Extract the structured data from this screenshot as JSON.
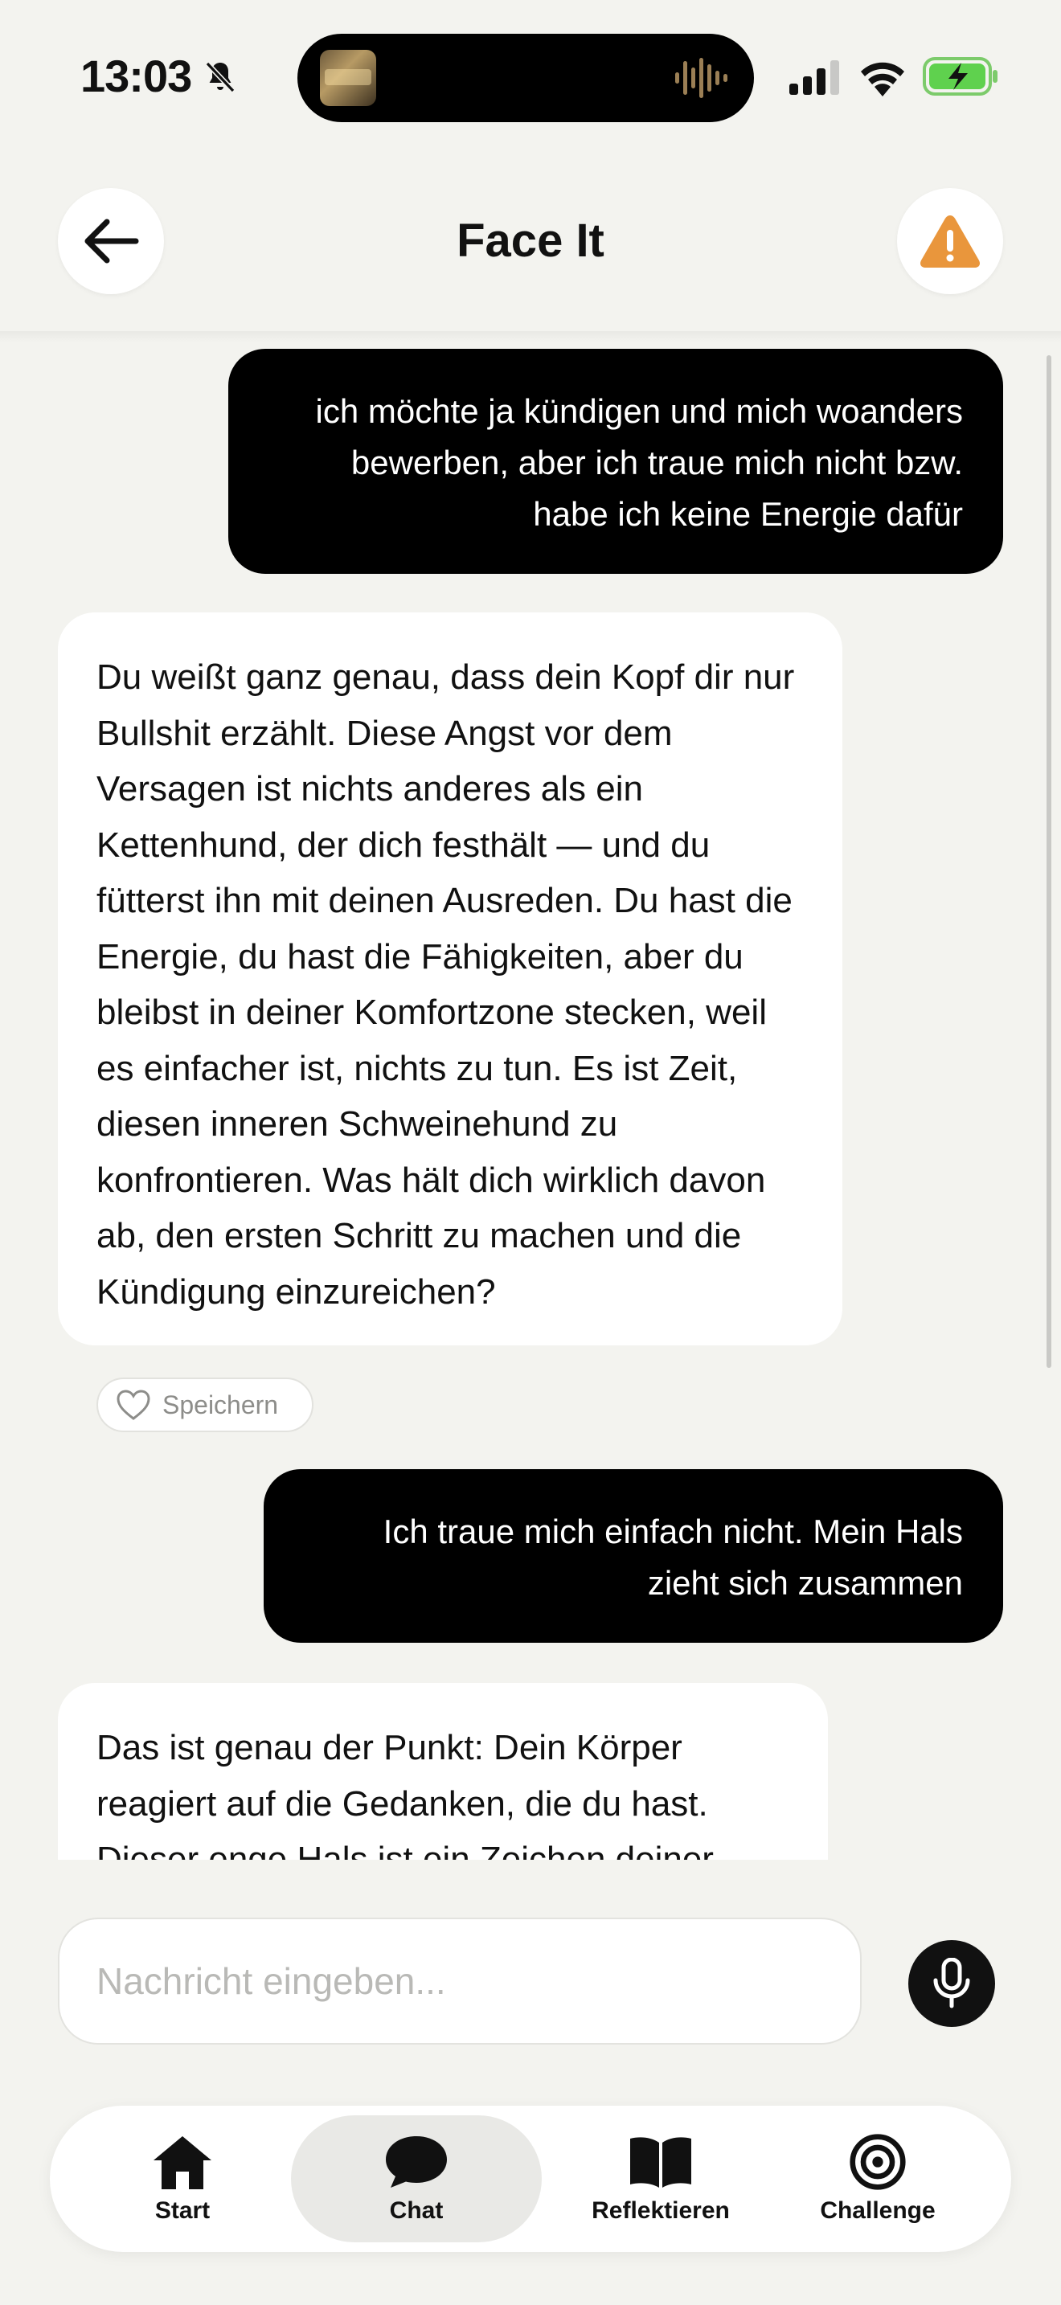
{
  "status_bar": {
    "time": "13:03"
  },
  "header": {
    "title": "Face It"
  },
  "messages": [
    {
      "role": "user",
      "text": "ich möchte ja kündigen und mich woanders bewerben, aber ich traue mich nicht bzw. habe ich keine Energie dafür"
    },
    {
      "role": "assistant",
      "text": "Du weißt ganz genau, dass dein Kopf dir nur Bullshit erzählt. Diese Angst vor dem Versagen ist nichts anderes als ein Kettenhund, der dich festhält — und du fütterst ihn mit deinen Ausreden. Du hast die Energie, du hast die Fähigkeiten, aber du bleibst in deiner Komfortzone stecken, weil es einfacher ist, nichts zu tun. Es ist Zeit, diesen inneren Schweinehund zu konfrontieren. Was hält dich wirklich davon ab, den ersten Schritt zu machen und die Kündigung einzureichen?"
    },
    {
      "role": "user",
      "text": "Ich traue mich einfach nicht. Mein Hals zieht sich zusammen"
    },
    {
      "role": "assistant",
      "text": "Das ist genau der Punkt: Dein Körper reagiert auf die Gedanken, die du hast. Dieser enge Hals ist ein Zeichen deiner"
    }
  ],
  "save_label": "Speichern",
  "input": {
    "placeholder": "Nachricht eingeben..."
  },
  "tabs": [
    {
      "label": "Start",
      "icon": "home-icon"
    },
    {
      "label": "Chat",
      "icon": "chat-icon",
      "active": true
    },
    {
      "label": "Reflektieren",
      "icon": "book-icon"
    },
    {
      "label": "Challenge",
      "icon": "target-icon"
    }
  ],
  "colors": {
    "accent_alert": "#E9963C",
    "user_bubble": "#000000",
    "background": "#F3F3EF"
  }
}
